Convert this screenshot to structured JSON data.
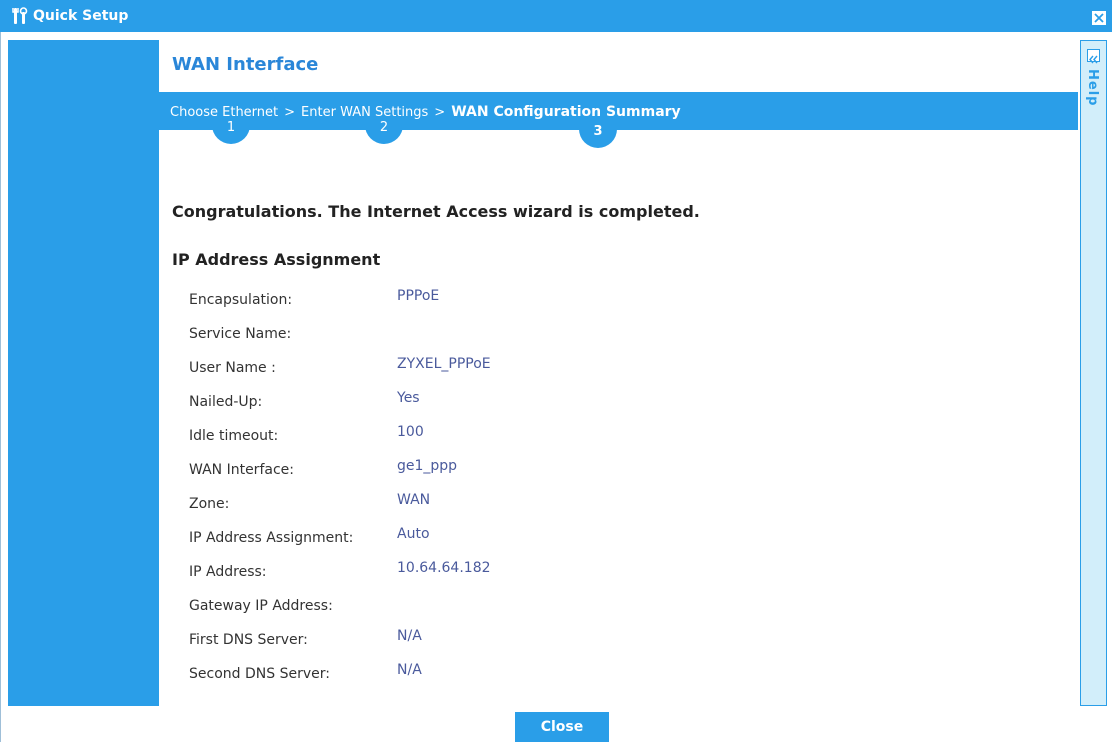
{
  "window": {
    "title": "Quick Setup"
  },
  "page": {
    "title": "WAN Interface"
  },
  "steps": {
    "crumbs": [
      {
        "label": "Choose Ethernet",
        "number": "1"
      },
      {
        "label": "Enter WAN Settings",
        "number": "2"
      },
      {
        "label": "WAN Configuration Summary",
        "number": "3"
      }
    ],
    "separator": ">"
  },
  "summary": {
    "message": "Congratulations. The Internet Access wizard is completed.",
    "section_title": "IP Address Assignment",
    "rows": [
      {
        "label": "Encapsulation:",
        "value": "PPPoE"
      },
      {
        "label": "Service Name:",
        "value": ""
      },
      {
        "label": "User Name :",
        "value": "ZYXEL_PPPoE"
      },
      {
        "label": "Nailed-Up:",
        "value": "Yes"
      },
      {
        "label": "Idle timeout:",
        "value": "100"
      },
      {
        "label": "WAN Interface:",
        "value": "ge1_ppp"
      },
      {
        "label": "Zone:",
        "value": "WAN"
      },
      {
        "label": "IP Address Assignment:",
        "value": "Auto"
      },
      {
        "label": "IP Address:",
        "value": "10.64.64.182"
      },
      {
        "label": "Gateway IP Address:",
        "value": ""
      },
      {
        "label": "First DNS Server:",
        "value": "N/A"
      },
      {
        "label": "Second DNS Server:",
        "value": "N/A"
      }
    ]
  },
  "help": {
    "label": "Help"
  },
  "footer": {
    "close_label": "Close"
  },
  "colors": {
    "accent": "#2a9ee8",
    "value_text": "#4a5a9c"
  },
  "icons": {
    "title_icon": "tools-icon",
    "window_close": "close-icon",
    "help_collapse": "double-chevron-left-icon"
  }
}
